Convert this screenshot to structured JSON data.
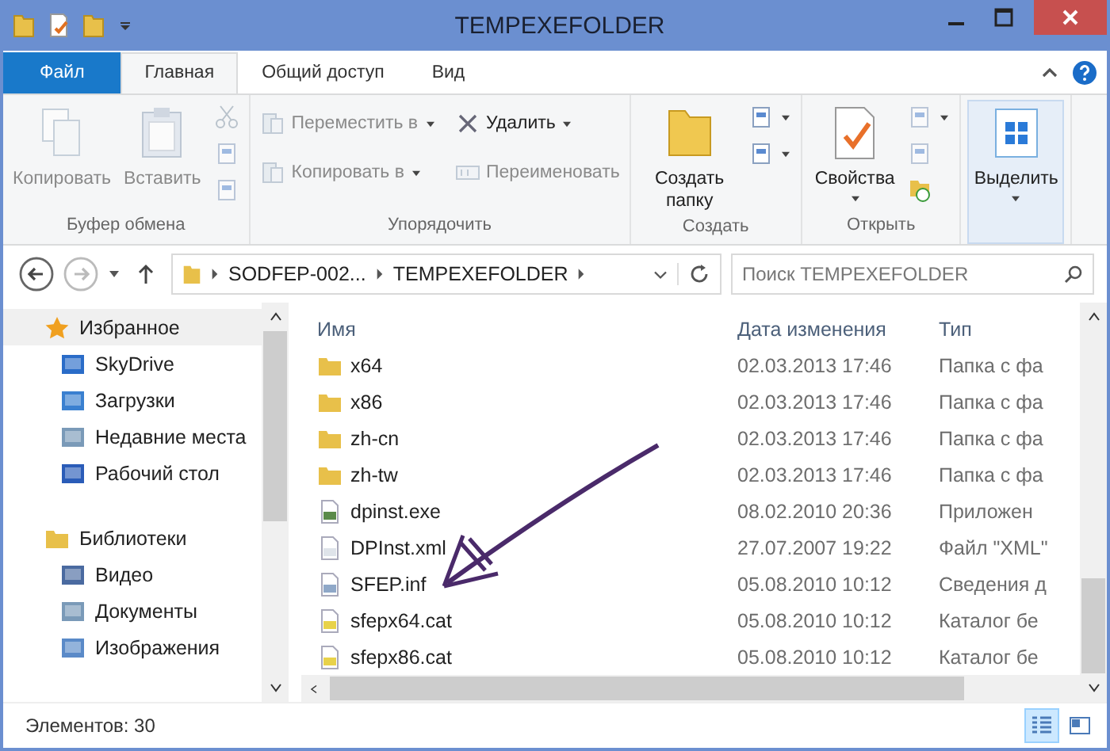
{
  "window": {
    "title": "TEMPEXEFOLDER"
  },
  "ribbon_tabs": [
    {
      "label": "Файл",
      "kind": "file",
      "selected": false
    },
    {
      "label": "Главная",
      "kind": "tab",
      "selected": true
    },
    {
      "label": "Общий доступ",
      "kind": "tab",
      "selected": false
    },
    {
      "label": "Вид",
      "kind": "tab",
      "selected": false
    }
  ],
  "ribbon_groups": [
    {
      "label": "Буфер обмена",
      "large": [
        {
          "label": "Копировать",
          "kind": "copy",
          "disabled": true,
          "dropdown": false,
          "selected": false
        },
        {
          "label": "Вставить",
          "kind": "paste",
          "disabled": true,
          "dropdown": false,
          "selected": false
        }
      ],
      "small": [
        {
          "kind": "cut",
          "disabled": true,
          "dropdown": false
        },
        {
          "kind": "path",
          "disabled": true,
          "dropdown": false
        },
        {
          "kind": "shortcut",
          "disabled": true,
          "dropdown": false
        }
      ]
    },
    {
      "label": "Упорядочить",
      "small": [
        {
          "label": "Переместить в",
          "kind": "move",
          "disabled": true,
          "dropdown": true
        },
        {
          "label": "Копировать в",
          "kind": "copyto",
          "disabled": true,
          "dropdown": true
        },
        {
          "label": "Удалить",
          "kind": "delete",
          "disabled": false,
          "dropdown": true
        },
        {
          "label": "Переименовать",
          "kind": "rename",
          "disabled": true,
          "dropdown": false
        }
      ]
    },
    {
      "label": "Создать",
      "large": [
        {
          "label": "Создать папку",
          "kind": "folder",
          "disabled": false,
          "dropdown": false,
          "selected": false
        }
      ],
      "small": [
        {
          "kind": "newitem",
          "disabled": false,
          "dropdown": true
        },
        {
          "kind": "access",
          "disabled": false,
          "dropdown": true
        }
      ]
    },
    {
      "label": "Открыть",
      "large": [
        {
          "label": "Свойства",
          "kind": "properties",
          "disabled": false,
          "dropdown": true,
          "selected": false
        }
      ],
      "small": [
        {
          "kind": "open",
          "disabled": true,
          "dropdown": true
        },
        {
          "kind": "edit",
          "disabled": true,
          "dropdown": false
        },
        {
          "kind": "history",
          "disabled": false,
          "dropdown": false
        }
      ]
    },
    {
      "large": [
        {
          "label": "Выделить",
          "kind": "select",
          "disabled": false,
          "dropdown": true,
          "selected": true
        }
      ]
    }
  ],
  "address": {
    "crumbs": [
      "SODFEP-002...",
      "TEMPEXEFOLDER"
    ]
  },
  "search": {
    "placeholder": "Поиск TEMPEXEFOLDER"
  },
  "sidebar": {
    "items": [
      {
        "label": "Избранное",
        "kind": "favorites",
        "selected": true,
        "children": [
          {
            "label": "SkyDrive",
            "kind": "skydrive",
            "selected": false
          },
          {
            "label": "Загрузки",
            "kind": "downloads",
            "selected": false
          },
          {
            "label": "Недавние места",
            "kind": "recent",
            "selected": false
          },
          {
            "label": "Рабочий стол",
            "kind": "desktop",
            "selected": false
          }
        ]
      },
      {
        "label": "Библиотеки",
        "kind": "libraries",
        "selected": false,
        "children": [
          {
            "label": "Видео",
            "kind": "video",
            "selected": false
          },
          {
            "label": "Документы",
            "kind": "documents",
            "selected": false
          },
          {
            "label": "Изображения",
            "kind": "pictures",
            "selected": false
          }
        ]
      }
    ]
  },
  "table": {
    "columns": [
      "Имя",
      "Дата изменения",
      "Тип"
    ],
    "rows": [
      {
        "name": "x64",
        "date": "02.03.2013 17:46",
        "type": "Папка с фа",
        "kind": "folder"
      },
      {
        "name": "x86",
        "date": "02.03.2013 17:46",
        "type": "Папка с фа",
        "kind": "folder"
      },
      {
        "name": "zh-cn",
        "date": "02.03.2013 17:46",
        "type": "Папка с фа",
        "kind": "folder"
      },
      {
        "name": "zh-tw",
        "date": "02.03.2013 17:46",
        "type": "Папка с фа",
        "kind": "folder"
      },
      {
        "name": "dpinst.exe",
        "date": "08.02.2010 20:36",
        "type": "Приложен",
        "kind": "exe"
      },
      {
        "name": "DPInst.xml",
        "date": "27.07.2007 19:22",
        "type": "Файл \"XML\"",
        "kind": "xml"
      },
      {
        "name": "SFEP.inf",
        "date": "05.08.2010 10:12",
        "type": "Сведения д",
        "kind": "inf"
      },
      {
        "name": "sfepx64.cat",
        "date": "05.08.2010 10:12",
        "type": "Каталог бе",
        "kind": "cat"
      },
      {
        "name": "sfepx86.cat",
        "date": "05.08.2010 10:12",
        "type": "Каталог бе",
        "kind": "cat"
      }
    ]
  },
  "status_bar": {
    "text": "Элементов: 30",
    "views": [
      {
        "kind": "details",
        "selected": true
      },
      {
        "kind": "thumbnails",
        "selected": false
      }
    ]
  }
}
